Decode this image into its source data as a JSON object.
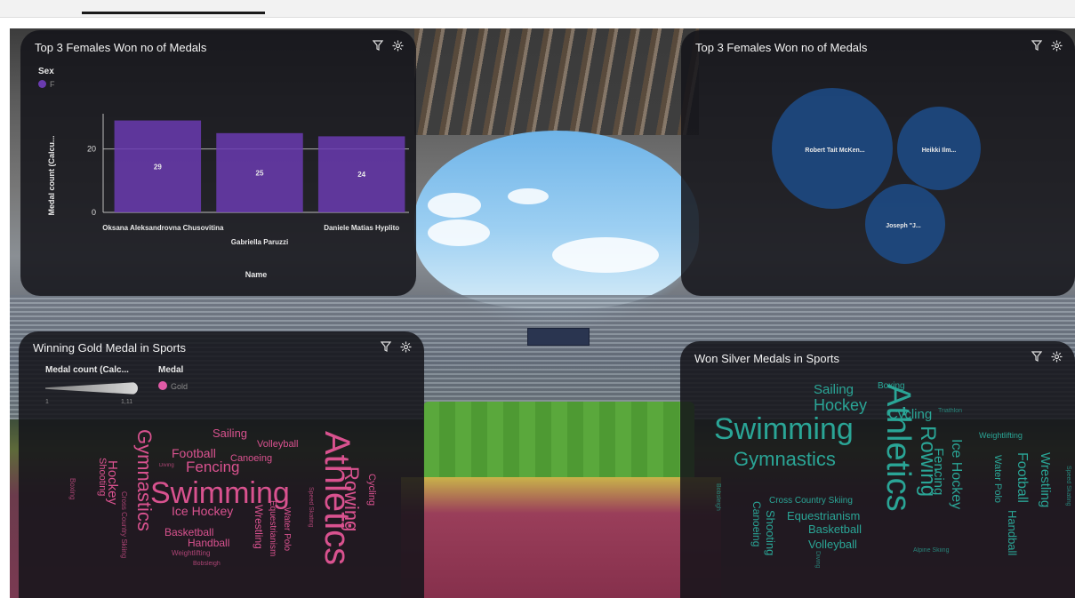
{
  "colors": {
    "female_bar": "#6a3bb0",
    "bubble": "#1d4f8f",
    "gold_words": "#d9528f",
    "silver_words": "#2aa596",
    "gold_legend": "#e05aa6"
  },
  "panels": {
    "females_bar": {
      "title": "Top 3 Females Won no of Medals",
      "legend_title": "Sex",
      "legend_item": "F",
      "filter_icon": "filter-icon",
      "settings_icon": "gear-icon"
    },
    "females_bubble": {
      "title": "Top 3 Females Won no of Medals",
      "filter_icon": "filter-icon",
      "settings_icon": "gear-icon"
    },
    "gold": {
      "title": "Winning Gold Medal in Sports",
      "legend_size_title": "Medal count (Calc...",
      "legend_size_min": "1",
      "legend_size_max": "1,11",
      "legend_color_title": "Medal",
      "legend_color_item": "Gold",
      "filter_icon": "filter-icon",
      "settings_icon": "gear-icon"
    },
    "silver": {
      "title": "Won Silver Medals in Sports",
      "filter_icon": "filter-icon",
      "settings_icon": "gear-icon"
    }
  },
  "chart_data": [
    {
      "type": "bar",
      "title": "Top 3 Females Won no of Medals",
      "categories": [
        "Oksana Aleksandrovna Chusovitina",
        "Gabriella Paruzzi",
        "Daniele Matias Hyplito"
      ],
      "values": [
        29,
        25,
        24
      ],
      "xlabel": "Name",
      "ylabel": "Medal count (Calcu...",
      "ylim": [
        0,
        30
      ],
      "yticks": [
        0,
        20
      ],
      "legend": {
        "title": "Sex",
        "items": [
          "F"
        ]
      },
      "grid": true
    },
    {
      "type": "bubble",
      "title": "Top 3 Females Won no of Medals",
      "labels": [
        "Robert Tait McKen...",
        "Heikki Ilm...",
        "Joseph \"J..."
      ]
    }
  ],
  "wordclouds": {
    "gold": [
      {
        "t": "Athletics",
        "s": 40,
        "r": 90
      },
      {
        "t": "Swimming",
        "s": 34,
        "r": 0
      },
      {
        "t": "Gymnastics",
        "s": 22,
        "r": 90
      },
      {
        "t": "Rowing",
        "s": 22,
        "r": 90
      },
      {
        "t": "Fencing",
        "s": 17,
        "r": 0
      },
      {
        "t": "Ice Hockey",
        "s": 14,
        "r": 0
      },
      {
        "t": "Hockey",
        "s": 15,
        "r": 90
      },
      {
        "t": "Football",
        "s": 14,
        "r": 0
      },
      {
        "t": "Sailing",
        "s": 13,
        "r": 0
      },
      {
        "t": "Basketball",
        "s": 12,
        "r": 0
      },
      {
        "t": "Handball",
        "s": 12,
        "r": 0
      },
      {
        "t": "Canoeing",
        "s": 11,
        "r": 0
      },
      {
        "t": "Volleyball",
        "s": 11,
        "r": 0
      },
      {
        "t": "Shooting",
        "s": 11,
        "r": 90
      },
      {
        "t": "Wrestling",
        "s": 12,
        "r": 90
      },
      {
        "t": "Water Polo",
        "s": 10,
        "r": 90
      },
      {
        "t": "Equestrianism",
        "s": 10,
        "r": 90
      },
      {
        "t": "Cycling",
        "s": 11,
        "r": 90
      },
      {
        "t": "Cross Country Skiing",
        "s": 8,
        "r": 90
      },
      {
        "t": "Weightlifting",
        "s": 8,
        "r": 0
      },
      {
        "t": "Boxing",
        "s": 8,
        "r": 90
      },
      {
        "t": "Bobsleigh",
        "s": 7,
        "r": 0
      },
      {
        "t": "Speed Skating",
        "s": 7,
        "r": 90
      },
      {
        "t": "Diving",
        "s": 6,
        "r": 0
      }
    ],
    "silver": [
      {
        "t": "Athletics",
        "s": 38,
        "r": 90
      },
      {
        "t": "Swimming",
        "s": 34,
        "r": 0
      },
      {
        "t": "Rowing",
        "s": 24,
        "r": 90
      },
      {
        "t": "Gymnastics",
        "s": 22,
        "r": 0
      },
      {
        "t": "Hockey",
        "s": 18,
        "r": 0
      },
      {
        "t": "Sailing",
        "s": 15,
        "r": 0
      },
      {
        "t": "Cycling",
        "s": 15,
        "r": 0
      },
      {
        "t": "Ice Hockey",
        "s": 16,
        "r": 90
      },
      {
        "t": "Fencing",
        "s": 15,
        "r": 90
      },
      {
        "t": "Football",
        "s": 16,
        "r": 90
      },
      {
        "t": "Wrestling",
        "s": 15,
        "r": 90
      },
      {
        "t": "Handball",
        "s": 13,
        "r": 90
      },
      {
        "t": "Water Polo",
        "s": 11,
        "r": 90
      },
      {
        "t": "Equestrianism",
        "s": 13,
        "r": 0
      },
      {
        "t": "Basketball",
        "s": 13,
        "r": 0
      },
      {
        "t": "Volleyball",
        "s": 13,
        "r": 0
      },
      {
        "t": "Shooting",
        "s": 13,
        "r": 90
      },
      {
        "t": "Canoeing",
        "s": 12,
        "r": 90
      },
      {
        "t": "Cross Country Skiing",
        "s": 10,
        "r": 0
      },
      {
        "t": "Boxing",
        "s": 10,
        "r": 0
      },
      {
        "t": "Weightlifting",
        "s": 9,
        "r": 0
      },
      {
        "t": "Speed Skating",
        "s": 7,
        "r": 90
      },
      {
        "t": "Alpine Skiing",
        "s": 7,
        "r": 0
      },
      {
        "t": "Triathlon",
        "s": 7,
        "r": 0
      },
      {
        "t": "Bobsleigh",
        "s": 7,
        "r": 90
      },
      {
        "t": "Diving",
        "s": 7,
        "r": 90
      }
    ]
  }
}
